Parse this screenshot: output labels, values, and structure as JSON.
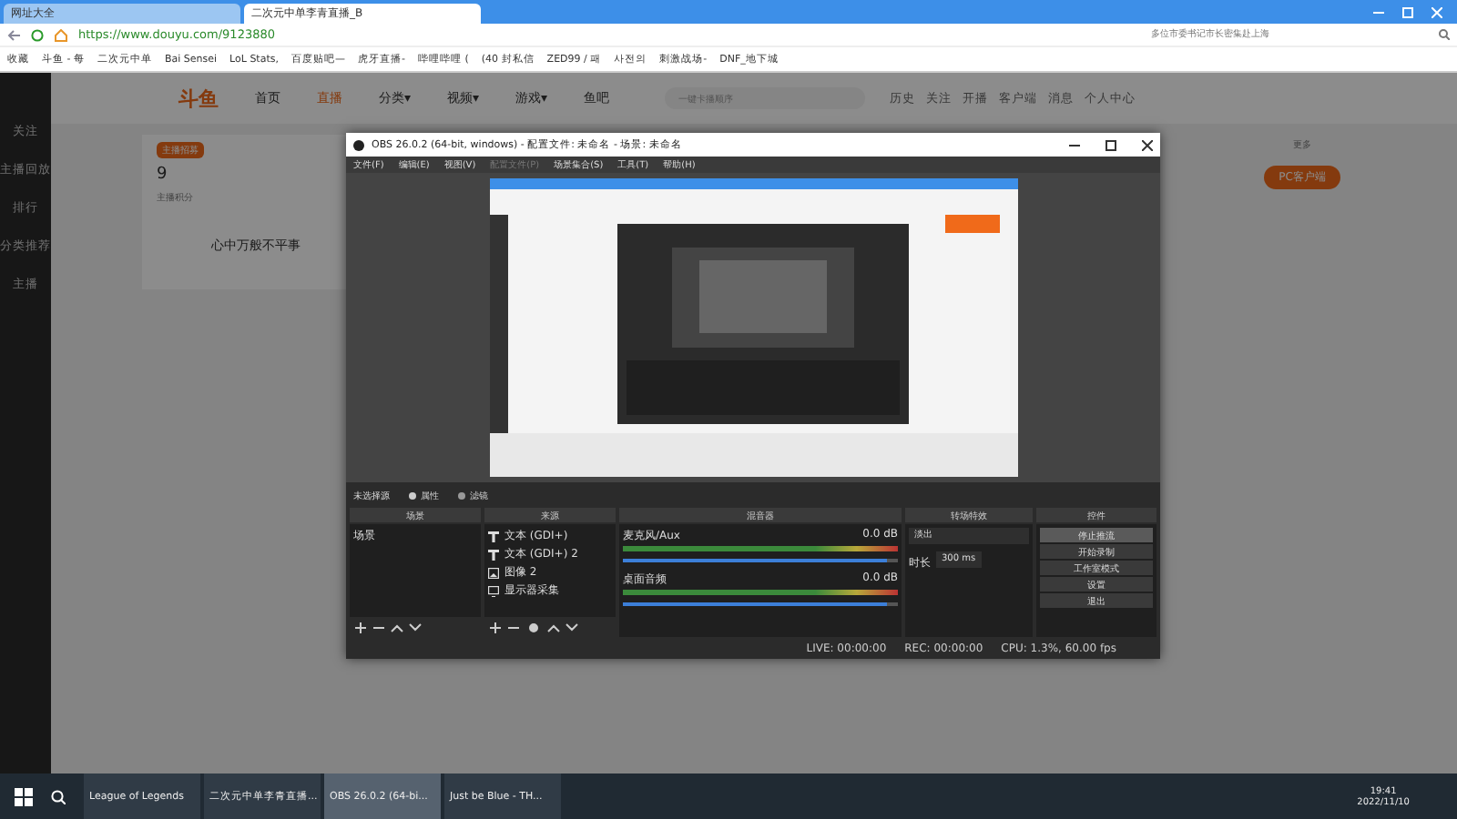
{
  "browser": {
    "tabs": [
      {
        "label": "网址大全",
        "selected": false
      },
      {
        "label": "二次元中单李青直播_B",
        "selected": true
      }
    ],
    "url": "https://www.douyu.com/9123880",
    "search": {
      "placeholder": "多位市委书记市长密集赴上海"
    },
    "bookmarks": [
      "收藏",
      "斗鱼 - 每",
      "二次元中单",
      "Bai Sensei",
      "LoL Stats,",
      "百度贴吧—",
      "虎牙直播-",
      "哔哩哔哩 (",
      "(40 封私信",
      "ZED99 / 패",
      "사전의",
      "刺激战场-",
      "DNF_地下城"
    ]
  },
  "site": {
    "logo": "斗鱼",
    "nav": [
      {
        "label": "首页",
        "selected": false
      },
      {
        "label": "直播",
        "selected": true
      },
      {
        "label": "分类▾",
        "selected": false
      },
      {
        "label": "视频▾",
        "selected": false
      },
      {
        "label": "游戏▾",
        "selected": false
      },
      {
        "label": "鱼吧",
        "selected": false
      }
    ],
    "search": {
      "placeholder": "一键卡播顺序"
    },
    "header_icons": [
      "历史",
      "关注",
      "开播",
      "客户端",
      "消息",
      "个人中心"
    ],
    "sidebar": [
      "关注",
      "主播回放",
      "排行",
      "分类推荐",
      "主播"
    ],
    "score": {
      "badge": "主播招募",
      "value": "9",
      "label": "主播积分"
    },
    "room_title": "心中万般不平事",
    "more": "更多",
    "client_button": "PC客户端"
  },
  "obs": {
    "title": "OBS 26.0.2 (64-bit, windows) - 配置文件: 未命名 - 场景: 未命名",
    "menu": [
      {
        "label": "文件(F)",
        "disabled": false
      },
      {
        "label": "编辑(E)",
        "disabled": false
      },
      {
        "label": "视图(V)",
        "disabled": false
      },
      {
        "label": "配置文件(P)",
        "disabled": true
      },
      {
        "label": "场景集合(S)",
        "disabled": false
      },
      {
        "label": "工具(T)",
        "disabled": false
      },
      {
        "label": "帮助(H)",
        "disabled": false
      }
    ],
    "no_source": "未选择源",
    "properties": "属性",
    "filters": "滤镜",
    "docks": {
      "scenes": "场景",
      "sources": "来源",
      "mixer": "混音器",
      "transitions": "转场特效",
      "controls": "控件"
    },
    "scenes": [
      {
        "label": "场景",
        "selected": false
      }
    ],
    "sources": [
      {
        "label": "文本 (GDI+)",
        "kind": "text"
      },
      {
        "label": "文本 (GDI+) 2",
        "kind": "text"
      },
      {
        "label": "图像 2",
        "kind": "image"
      },
      {
        "label": "显示器采集",
        "kind": "display"
      }
    ],
    "mixer": [
      {
        "name": "麦克风/Aux",
        "reading": "0.0 dB",
        "level": 0.96
      },
      {
        "name": "桌面音频",
        "reading": "0.0 dB",
        "level": 0.96
      }
    ],
    "transition": {
      "value": "淡出",
      "duration_label": "时长",
      "duration": "300 ms"
    },
    "controls": [
      {
        "label": "停止推流",
        "selected": true
      },
      {
        "label": "开始录制",
        "selected": false
      },
      {
        "label": "工作室模式",
        "selected": false
      },
      {
        "label": "设置",
        "selected": false
      },
      {
        "label": "退出",
        "selected": false
      }
    ],
    "status": {
      "live": "LIVE: 00:00:00",
      "rec": "REC: 00:00:00",
      "cpu": "CPU: 1.3%, 60.00 fps"
    }
  },
  "taskbar": {
    "apps": [
      {
        "label": "League of Legends",
        "selected": false
      },
      {
        "label": "二次元中单李青直播...",
        "selected": false
      },
      {
        "label": "OBS 26.0.2 (64-bi...",
        "selected": true
      },
      {
        "label": "Just be Blue - TH...",
        "selected": false
      }
    ],
    "time": "19:41",
    "date": "2022/11/10"
  }
}
